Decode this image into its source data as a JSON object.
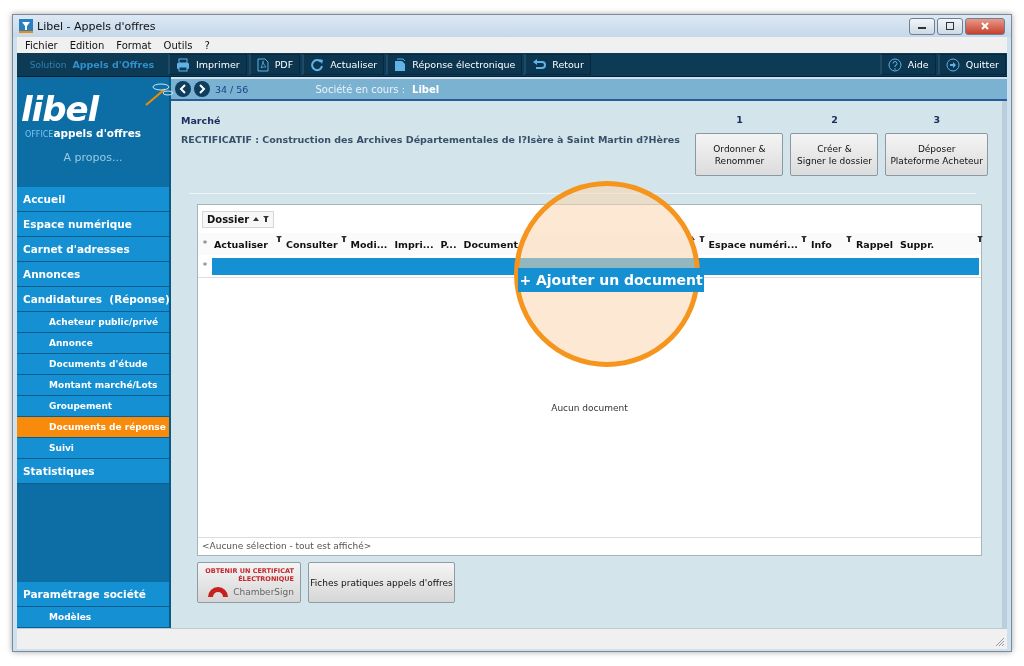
{
  "window": {
    "title": "Libel - Appels d'offres"
  },
  "menu": [
    "Fichier",
    "Edition",
    "Format",
    "Outils",
    "?"
  ],
  "toolbar": {
    "brand": {
      "prefix": "Solution",
      "name": "Appels d'Offres"
    },
    "buttons": [
      {
        "label": "Imprimer",
        "kind": "printer"
      },
      {
        "label": "PDF",
        "kind": "pdf"
      },
      {
        "label": "Actualiser",
        "kind": "refresh"
      },
      {
        "label": "Réponse électronique",
        "kind": "document"
      },
      {
        "label": "Retour",
        "kind": "back"
      }
    ],
    "right_buttons": [
      {
        "label": "Aide",
        "kind": "help"
      },
      {
        "label": "Quitter",
        "kind": "exit"
      }
    ]
  },
  "sidebar": {
    "logo": {
      "wordmark": "libel",
      "tagline_prefix": "OFFICE",
      "tagline": "appels d'offres"
    },
    "about": "A propos...",
    "items": [
      {
        "label": "Accueil",
        "selected": false
      },
      {
        "label": "Espace numérique",
        "selected": false
      },
      {
        "label": "Carnet d'adresses",
        "selected": false
      },
      {
        "label": "Annonces",
        "selected": false
      },
      {
        "label": "Candidatures  (Réponse)",
        "selected": false,
        "children": [
          {
            "label": "Acheteur public/privé",
            "selected": false
          },
          {
            "label": "Annonce",
            "selected": false
          },
          {
            "label": "Documents d'étude",
            "selected": false
          },
          {
            "label": "Montant marché/Lots",
            "selected": false
          },
          {
            "label": "Groupement",
            "selected": false
          },
          {
            "label": "Documents de réponse",
            "selected": true
          },
          {
            "label": "Suivi",
            "selected": false
          }
        ]
      },
      {
        "label": "Statistiques",
        "selected": false
      }
    ],
    "bottom_items": [
      {
        "label": "Paramétrage société",
        "selected": false,
        "children": [
          {
            "label": "Modèles",
            "selected": false
          }
        ]
      }
    ]
  },
  "nav": {
    "position": "34 / 56",
    "company_label": "Société en cours :",
    "company": "Libel"
  },
  "marche": {
    "heading": "Marché",
    "title": "RECTIFICATIF : Construction des Archives Départementales de l?Isère à Saint Martin d?Hères"
  },
  "steps": [
    {
      "number": "1",
      "lines": [
        "Ordonner &",
        "Renommer"
      ]
    },
    {
      "number": "2",
      "lines": [
        "Créer &",
        "Signer le dossier"
      ]
    },
    {
      "number": "3",
      "lines": [
        "Déposer",
        "Plateforme Acheteur"
      ]
    }
  ],
  "grid": {
    "group_by": {
      "label": "Dossier",
      "sorted": true,
      "filter": true
    },
    "header_marker": "*",
    "columns": [
      {
        "label": "Actualiser",
        "filter": true,
        "sorted": false
      },
      {
        "label": "Consulter",
        "filter": true,
        "sorted": false
      },
      {
        "label": "Modi...",
        "filter": false,
        "sorted": false
      },
      {
        "label": "Impri...",
        "filter": false,
        "sorted": false
      },
      {
        "label": "P...",
        "filter": false,
        "sorted": false
      },
      {
        "label": "Document",
        "filter": true,
        "sorted": true
      },
      {
        "label": "Espace numéri...",
        "filter": true,
        "sorted": false
      },
      {
        "label": "Info",
        "filter": true,
        "sorted": false
      },
      {
        "label": "Rappel",
        "filter": false,
        "sorted": false
      },
      {
        "label": "Suppr.",
        "filter": true,
        "sorted": false
      }
    ],
    "new_row_marker": "*",
    "add_button": "+ Ajouter un document",
    "highlighted": true,
    "empty": "Aucun document",
    "footer": "<Aucune sélection - tout est affiché>"
  },
  "bottom_buttons": [
    {
      "kind": "certificate",
      "lines": [
        "OBTENIR UN CERTIFICAT",
        "ÉLECTRONIQUE"
      ],
      "brand": "ChamberSign"
    },
    {
      "kind": "text",
      "label": "Fiches pratiques appels d'offres"
    }
  ]
}
